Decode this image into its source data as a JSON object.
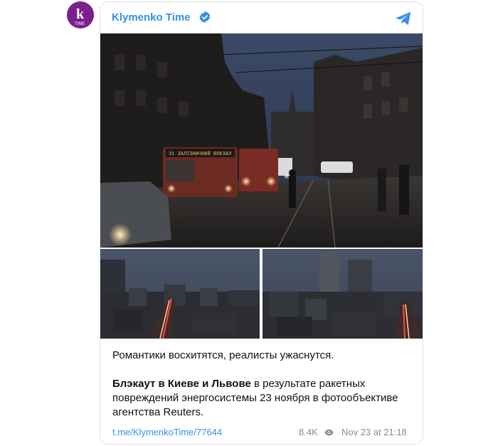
{
  "channel": {
    "name": "Klymenko Time",
    "avatar_icon": "klymenko-time-logo",
    "verified_icon": "verified-badge-icon",
    "platform_icon": "telegram-icon"
  },
  "post": {
    "line1": "Романтики восхитятся, реалисты ужаснутся.",
    "bold_part": "Блэкаут в Киеве и Львове",
    "rest": " в результате ракетных повреждений энергосистемы 23 ноября в фотообъективе агентства Reuters.",
    "bus_sign": "31 ЗАЛІЗНИЧНИЙ ВОКЗАЛ"
  },
  "footer": {
    "link": "t.me/KlymenkoTime/77644",
    "views": "8.4K",
    "date": "Nov 23 at 21:18"
  },
  "colors": {
    "accent": "#3390ec",
    "avatar_bg": "#7a1f8c"
  }
}
